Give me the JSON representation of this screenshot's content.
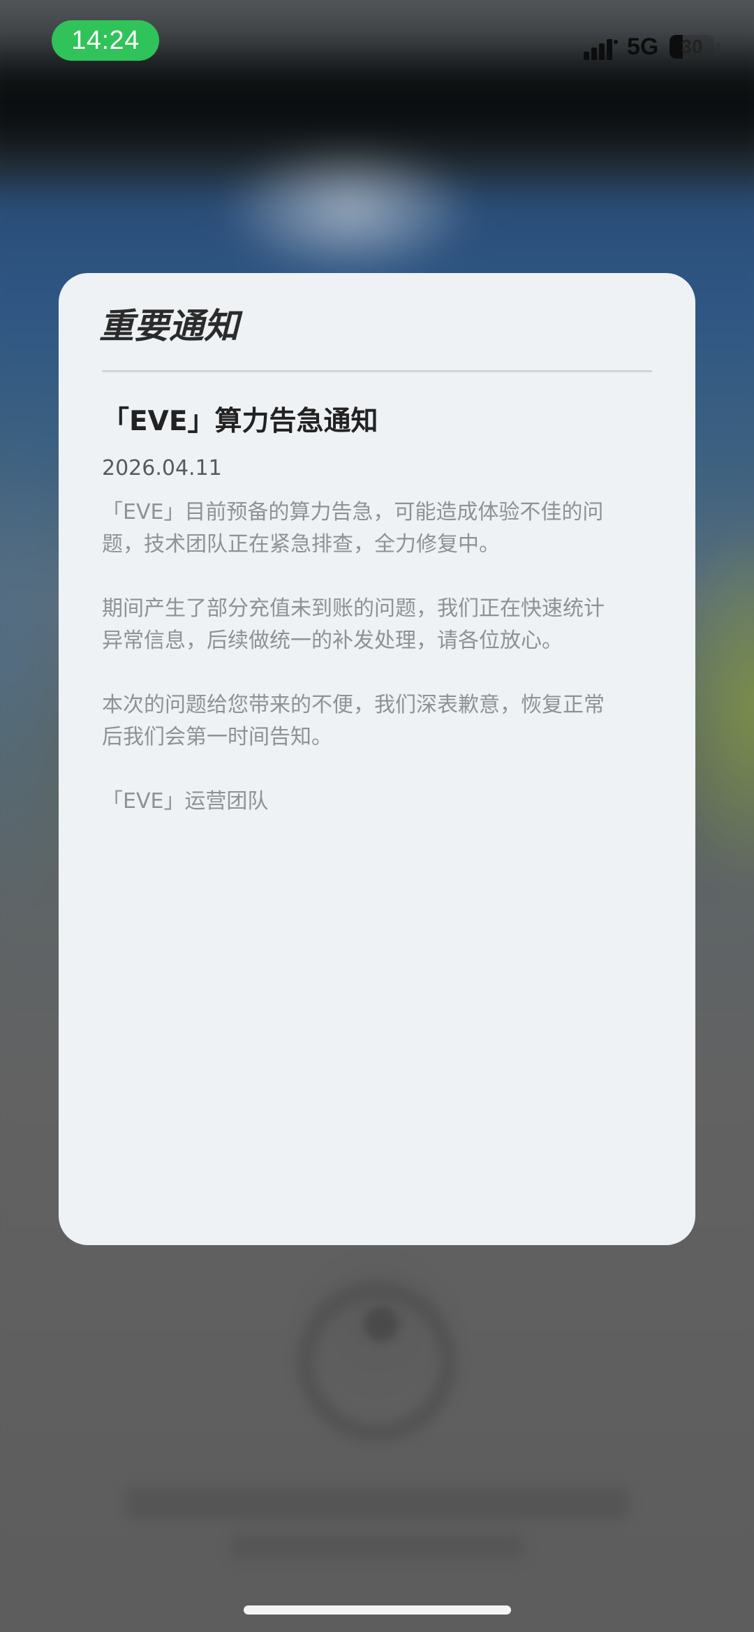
{
  "status_bar": {
    "time": "14:24",
    "network": "5G",
    "battery_level": "30",
    "battery_fraction": 0.3,
    "time_pill_color": "#2fc35a"
  },
  "dialog": {
    "header": "重要通知",
    "notice_title": "「EVE」算力告急通知",
    "date": "2026.04.11",
    "paragraphs": [
      "「EVE」目前预备的算力告急，可能造成体验不佳的问\n题，技术团队正在紧急排查，全力修复中。",
      "期间产生了部分充值未到账的问题，我们正在快速统计\n异常信息，后续做统一的补发处理，请各位放心。",
      "本次的问题给您带来的不便，我们深表歉意，恢复正常\n后我们会第一时间告知。"
    ],
    "signature": "「EVE」运营团队",
    "background_color": "#eef2f5"
  },
  "icons": {
    "signal": "cellular-signal-icon",
    "battery": "battery-icon"
  }
}
